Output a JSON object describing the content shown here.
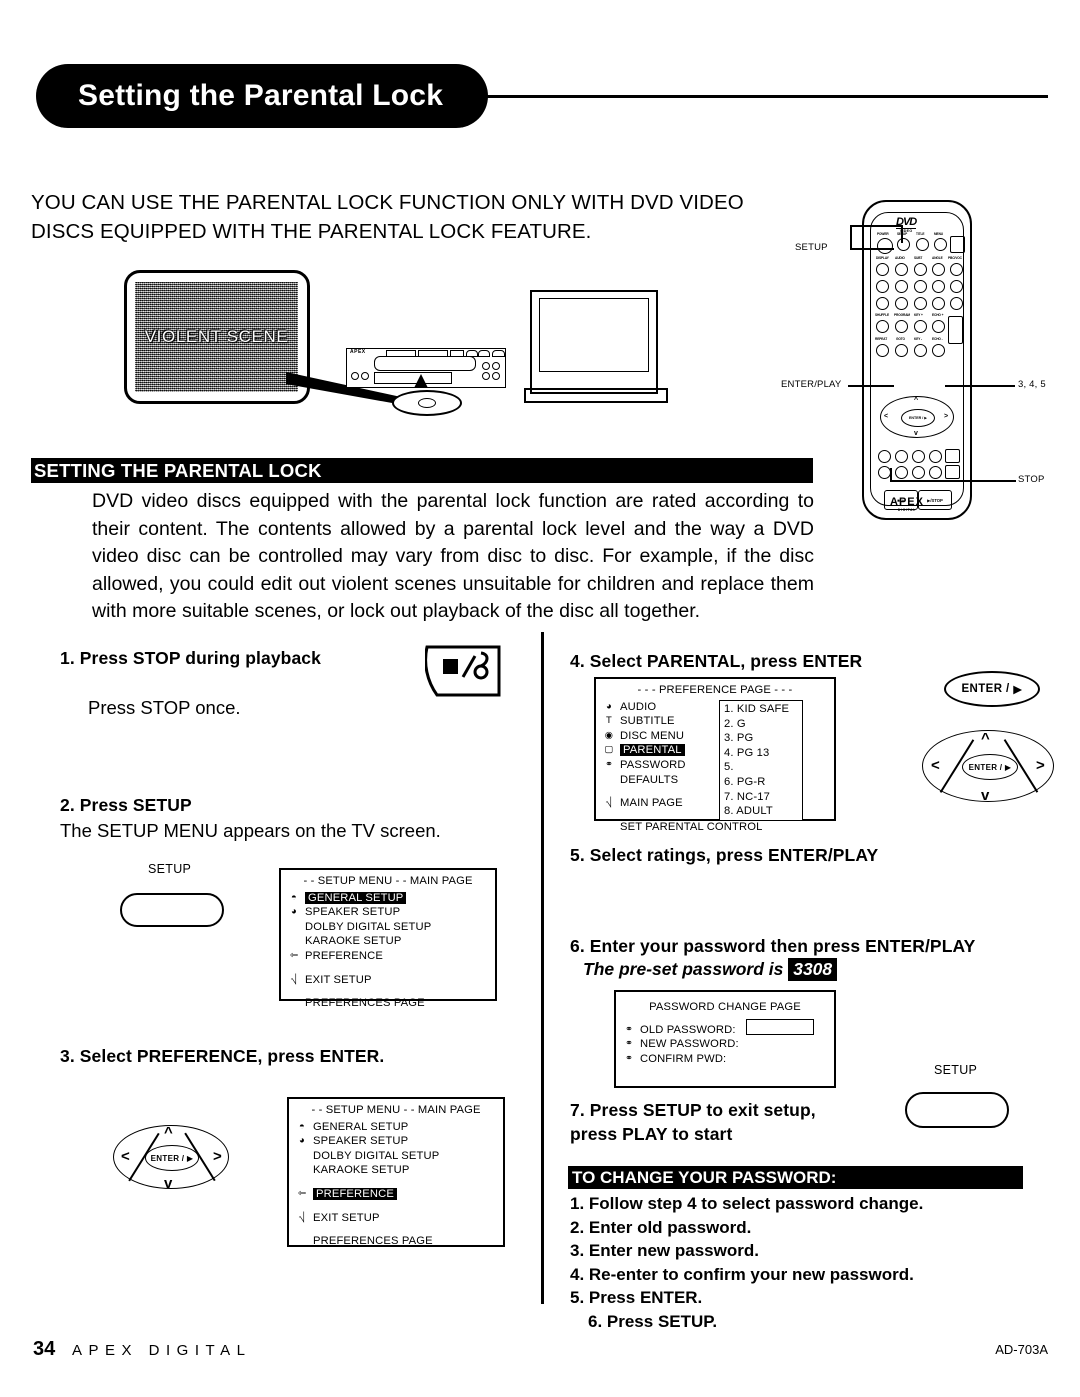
{
  "header": {
    "title": "Setting the Parental Lock"
  },
  "intro": {
    "line1": "YOU CAN USE THE PARENTAL LOCK FUNCTION ONLY WITH DVD VIDEO",
    "line2": "DISCS EQUIPPED WITH THE PARENTAL LOCK FEATURE."
  },
  "illustration": {
    "screen_caption": "VIOLENT SCENE",
    "player_brand": "APEX"
  },
  "section": {
    "bar_title": "SETTING THE PARENTAL LOCK",
    "body": "DVD video discs equipped with the parental lock function are rated according to their content.  The contents allowed by a parental lock level and the way a DVD video disc can be controlled may vary from disc to disc.  For example, if the disc allowed, you could edit out violent scenes unsuitable for children and replace them with more suitable scenes, or lock out playback of the disc all together."
  },
  "remote": {
    "dvd_logo": "DVD",
    "dvd_logo_sub": "VIDEO",
    "brand": "APEX",
    "brand_sub": "DIGITAL",
    "enter_label": "ENTER /",
    "stop_left": "■/⏏",
    "stop_right": "▶/STOP",
    "callouts": {
      "setup": "SETUP",
      "enter_play": "ENTER/PLAY",
      "steps": "3, 4, 5",
      "stop": "STOP"
    }
  },
  "left_column": {
    "step1": {
      "heading": "1. Press STOP during playback",
      "body": "Press STOP once."
    },
    "step2": {
      "heading": "2. Press SETUP",
      "body": "The SETUP MENU appears on the TV screen.",
      "button_label": "SETUP",
      "menu": {
        "title": "- - SETUP MENU  - -  MAIN PAGE",
        "items": [
          {
            "icon": "tv-icon",
            "glyph": "◔",
            "label": "GENERAL SETUP",
            "highlighted": true
          },
          {
            "icon": "speaker-icon",
            "glyph": "◁",
            "label": "SPEAKER SETUP",
            "highlighted": false
          },
          {
            "icon": "none",
            "glyph": "",
            "label": "DOLBY DIGITAL SETUP",
            "highlighted": false
          },
          {
            "icon": "none",
            "glyph": "",
            "label": "KARAOKE SETUP",
            "highlighted": false
          },
          {
            "icon": "arrow-icon",
            "glyph": "↩",
            "label": "PREFERENCE",
            "highlighted": false
          }
        ],
        "exit": {
          "icon": "door-icon",
          "glyph": "⌷",
          "label": "EXIT SETUP"
        },
        "footer": "PREFERENCES PAGE"
      }
    },
    "step3": {
      "heading": "3. Select PREFERENCE, press ENTER.",
      "dpad_center": "ENTER /",
      "menu": {
        "title": "- - SETUP MENU  - -  MAIN PAGE",
        "items": [
          {
            "icon": "tv-icon",
            "glyph": "◔",
            "label": "GENERAL SETUP",
            "highlighted": false
          },
          {
            "icon": "speaker-icon",
            "glyph": "◁",
            "label": "SPEAKER SETUP",
            "highlighted": false
          },
          {
            "icon": "none",
            "glyph": "",
            "label": "DOLBY DIGITAL SETUP",
            "highlighted": false
          },
          {
            "icon": "none",
            "glyph": "",
            "label": "KARAOKE SETUP",
            "highlighted": false
          },
          {
            "icon": "arrow-icon",
            "glyph": "↩",
            "label": "PREFERENCE",
            "highlighted": true
          }
        ],
        "exit": {
          "icon": "door-icon",
          "glyph": "⌷",
          "label": "EXIT SETUP"
        },
        "footer": "PREFERENCES PAGE"
      }
    }
  },
  "right_column": {
    "step4": {
      "heading": "4. Select PARENTAL, press ENTER",
      "menu": {
        "title": "- - - PREFERENCE PAGE - - -",
        "items": [
          {
            "icon": "speaker-icon",
            "glyph": "◁",
            "label": "AUDIO",
            "highlighted": false
          },
          {
            "icon": "subtitle-icon",
            "glyph": "T",
            "label": "SUBTITLE",
            "highlighted": false
          },
          {
            "icon": "disc-icon",
            "glyph": "◎",
            "label": "DISC MENU",
            "highlighted": false
          },
          {
            "icon": "parental-icon",
            "glyph": "□",
            "label": "PARENTAL",
            "highlighted": true
          },
          {
            "icon": "key-icon",
            "glyph": "⚷",
            "label": "PASSWORD",
            "highlighted": false
          },
          {
            "icon": "none",
            "glyph": "",
            "label": "DEFAULTS",
            "highlighted": false
          }
        ],
        "exit": {
          "icon": "door-icon",
          "glyph": "⌷",
          "label": "MAIN PAGE"
        },
        "footer": "SET PARENTAL CONTROL",
        "ratings": [
          "1. KID SAFE",
          "2. G",
          "3. PG",
          "4. PG 13",
          "5.",
          "6. PG-R",
          "7. NC-17",
          "8. ADULT"
        ]
      },
      "enter_label": "ENTER /",
      "dpad_center": "ENTER /"
    },
    "step5": {
      "heading": "5. Select ratings, press ENTER/PLAY"
    },
    "step6": {
      "heading": "6. Enter your password then press ENTER/PLAY",
      "note_prefix": "The pre-set password is",
      "password": "3308",
      "dialog": {
        "title": "PASSWORD CHANGE PAGE",
        "rows": [
          {
            "icon": "key-icon",
            "glyph": "⚷",
            "label": "OLD PASSWORD:",
            "has_field": true
          },
          {
            "icon": "key-icon",
            "glyph": "⚷",
            "label": "NEW PASSWORD:",
            "has_field": false
          },
          {
            "icon": "key-icon",
            "glyph": "⚷",
            "label": "CONFIRM PWD:",
            "has_field": false
          }
        ]
      }
    },
    "step7": {
      "heading_line1": "7. Press SETUP to exit setup,",
      "heading_line2": "press PLAY to start",
      "button_label": "SETUP"
    },
    "password_section": {
      "bar_title": "TO CHANGE YOUR PASSWORD:",
      "steps": [
        "1. Follow step 4 to select password change.",
        "2. Enter old password.",
        "3. Enter new password.",
        "4. Re-enter to confirm your new password.",
        "5. Press ENTER.",
        "6. Press SETUP."
      ]
    }
  },
  "footer": {
    "page_number": "34",
    "brand": "APEX DIGITAL",
    "model": "AD-703A"
  }
}
